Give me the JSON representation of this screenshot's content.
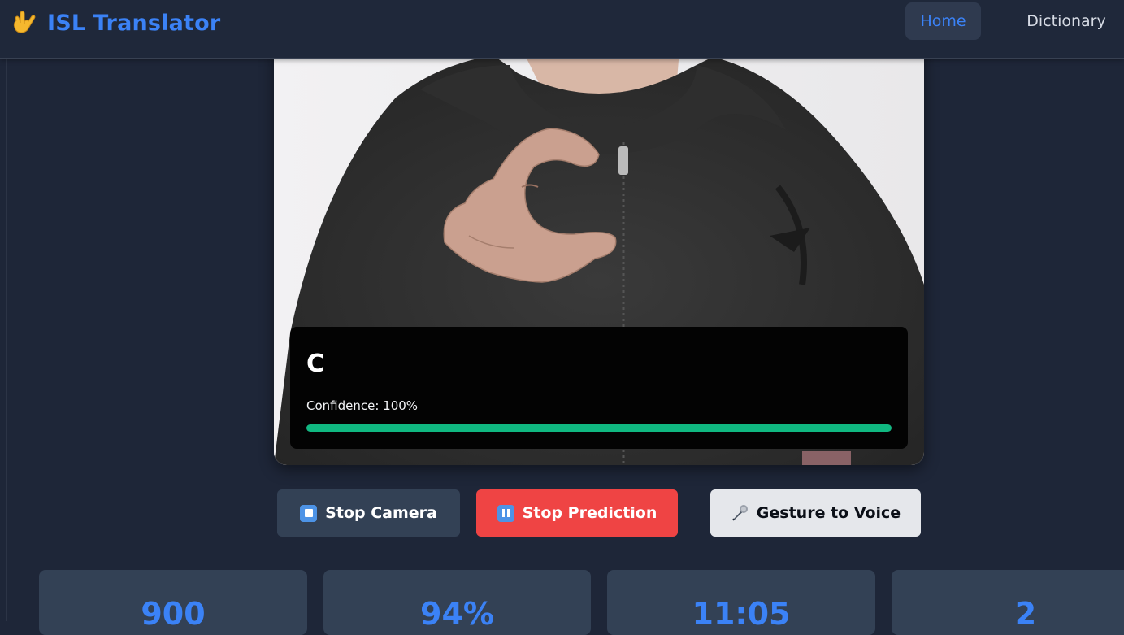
{
  "app": {
    "brand_title": "ISL Translator",
    "brand_icon": "love-you-hand-icon"
  },
  "nav": {
    "home_label": "Home",
    "dictionary_label": "Dictionary",
    "active": "Home"
  },
  "prediction": {
    "letter": "C",
    "confidence_label": "Confidence: 100%",
    "confidence_value": 1.0
  },
  "controls": {
    "stop_camera_label": "Stop Camera",
    "stop_camera_icon": "stop-square-icon",
    "stop_prediction_label": "Stop Prediction",
    "stop_prediction_icon": "pause-icon",
    "gesture_voice_label": "Gesture to Voice",
    "gesture_voice_icon": "microphone-icon"
  },
  "stats": [
    "900",
    "94%",
    "11:05",
    "2"
  ],
  "colors": {
    "accent": "#3b82f6",
    "danger": "#ef4444",
    "success": "#10b981",
    "background": "#1e2638",
    "card": "#334155"
  }
}
